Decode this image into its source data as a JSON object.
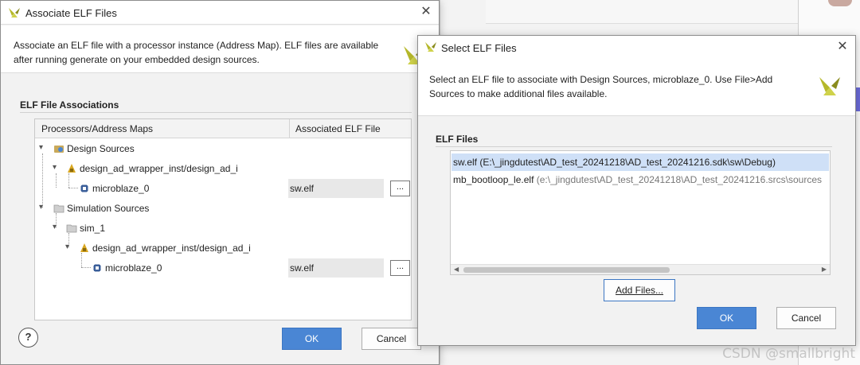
{
  "assoc_dialog": {
    "title": "Associate ELF Files",
    "description_line1": "Associate an ELF file with a processor instance (Address Map). ELF files are available",
    "description_line2": "after running generate on your embedded design sources.",
    "section_title": "ELF File Associations",
    "columns": [
      "Processors/Address Maps",
      "Associated ELF File"
    ],
    "tree": {
      "design_sources": "Design Sources",
      "design_instance": "design_ad_wrapper_inst/design_ad_i",
      "design_mb": "microblaze_0",
      "design_elf": "sw.elf",
      "sim_sources": "Simulation Sources",
      "sim_1": "sim_1",
      "sim_instance": "design_ad_wrapper_inst/design_ad_i",
      "sim_mb": "microblaze_0",
      "sim_elf": "sw.elf",
      "browse_label": "..."
    },
    "help_label": "?",
    "ok_label": "OK",
    "cancel_label": "Cancel"
  },
  "select_dialog": {
    "title": "Select ELF Files",
    "description_line1": "Select an ELF file to associate with Design Sources, microblaze_0. Use File>Add",
    "description_line2": "Sources to make additional files available.",
    "section_title": "ELF Files",
    "files": [
      {
        "name": "sw.elf",
        "path": "(E:\\_jingdutest\\AD_test_20241218\\AD_test_20241216.sdk\\sw\\Debug)"
      },
      {
        "name": "mb_bootloop_le.elf",
        "path": "(e:\\_jingdutest\\AD_test_20241218\\AD_test_20241216.srcs\\sources"
      }
    ],
    "add_files_label": "Add Files...",
    "ok_label": "OK",
    "cancel_label": "Cancel"
  },
  "watermark": "CSDN @smallbright",
  "colors": {
    "accent": "#4a86d4",
    "selection": "#cfe0f7",
    "vivado_logo": "#b5b82a"
  }
}
